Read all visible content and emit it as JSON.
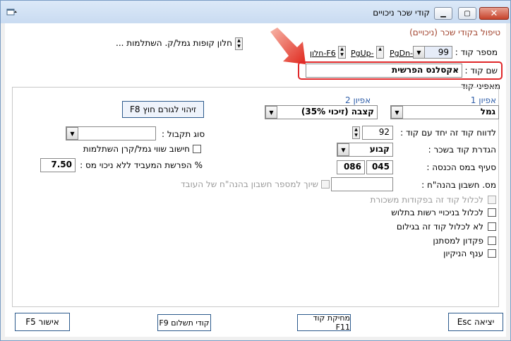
{
  "window": {
    "title": "קודי שכר ניכויים"
  },
  "header": {
    "title": "טיפול בקודי שכר (ניכויים)",
    "code_number_label": "מספר קוד :",
    "code_number_value": "99",
    "pgdn_label": "PgDn-",
    "pgup_label": "PgUp-",
    "window_f6_label": "חלון-F6",
    "funds_window_label": "חלון קופות גמל/ק. השתלמות ...",
    "code_name_label": "שם קוד :",
    "code_name_value": "אקסלנס הפרשית"
  },
  "group": {
    "title": "מאפיני קוד",
    "char1_label": "אפיון 1",
    "char1_value": "גמל",
    "char2_label": "אפיון 2",
    "char2_value": "קצבה (זיכוי 35%)",
    "external_id_button": "זיהוי לגורם חוץ F8",
    "report_with_code_label": "לדווח קוד זה יחד עם קוד :",
    "report_with_code_value": "92",
    "acceptance_type_label": "סוג תקבול :",
    "acceptance_type_value": "",
    "payroll_def_label": "הגדרת קוד בשכר :",
    "payroll_def_value": "קבוע",
    "calc_fund_label": "חישוב שווי גמל/קרן השתלמות",
    "tax_section_label": "סעיף במס הכנסה :",
    "tax_section_a": "045",
    "tax_section_b": "086",
    "employer_percent_label": "% הפרשת המעביד ללא ניכוי מס :",
    "employer_percent_value": "7.50",
    "accounting_no_label": "מס. חשבון בהנה\"ח :",
    "accounting_no_value": "",
    "assign_employee_label": "שיוך למספר חשבון בהנה\"ח של העובד",
    "include_salary_label": "לכלול קוד זה בפקודות משכורת",
    "include_deductions_label": "לכלול בניכויי רשות בתלוש",
    "exclude_slip_label": "לא לכלול קוד זה בגילום",
    "deposit_label": "פקדון למסתנן",
    "cleaning_label": "ענף הניקיון"
  },
  "footer": {
    "exit_button": "יציאה Esc",
    "delete_button": "מחיקת קוד F11",
    "payment_codes_button": "קודי תשלום F9",
    "confirm_button": "אישור F5"
  },
  "colors": {
    "header_title": "#a0402a",
    "highlight": "#e0282a",
    "button_border": "#2c5a8c"
  }
}
